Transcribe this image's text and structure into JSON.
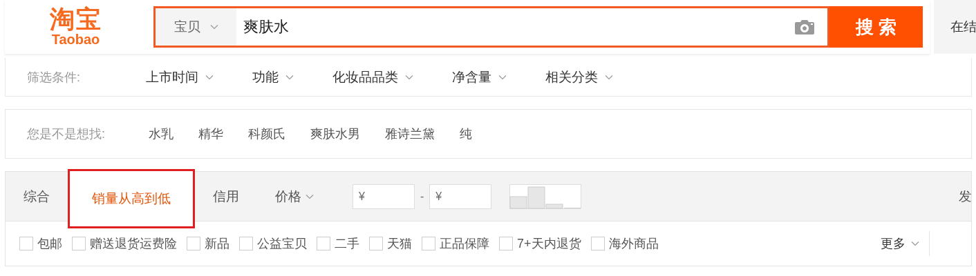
{
  "logo": {
    "mark": "淘宝",
    "wordmark": "Taobao"
  },
  "search": {
    "scope": "宝贝",
    "value": "爽肤水",
    "button": "搜 索"
  },
  "header_side": {
    "text": "在结"
  },
  "filters": {
    "label": "筛选条件:",
    "items": [
      "上市时间",
      "功能",
      "化妆品品类",
      "净含量",
      "相关分类"
    ]
  },
  "suggestions": {
    "label": "您是不是想找:",
    "items": [
      "水乳",
      "精华",
      "科颜氏",
      "爽肤水男",
      "雅诗兰黛",
      "纯"
    ]
  },
  "sort_tabs": [
    {
      "label": "综合",
      "selected": false,
      "kind": "plain"
    },
    {
      "label": "销量从高到低",
      "selected": true,
      "kind": "plain"
    },
    {
      "label": "信用",
      "selected": false,
      "kind": "plain"
    },
    {
      "label": "价格",
      "selected": false,
      "kind": "dropdown"
    }
  ],
  "price": {
    "min_placeholder": "¥",
    "separator": "-",
    "max_placeholder": "¥"
  },
  "sort_side": {
    "text": "发"
  },
  "options": [
    {
      "label": "包邮",
      "checked": false
    },
    {
      "label": "赠送退货运费险",
      "checked": false
    },
    {
      "label": "新品",
      "checked": false
    },
    {
      "label": "公益宝贝",
      "checked": false
    },
    {
      "label": "二手",
      "checked": false
    },
    {
      "label": "天猫",
      "checked": false
    },
    {
      "label": "正品保障",
      "checked": false
    },
    {
      "label": "7+天内退货",
      "checked": false
    },
    {
      "label": "海外商品",
      "checked": false
    }
  ],
  "more": "更多"
}
